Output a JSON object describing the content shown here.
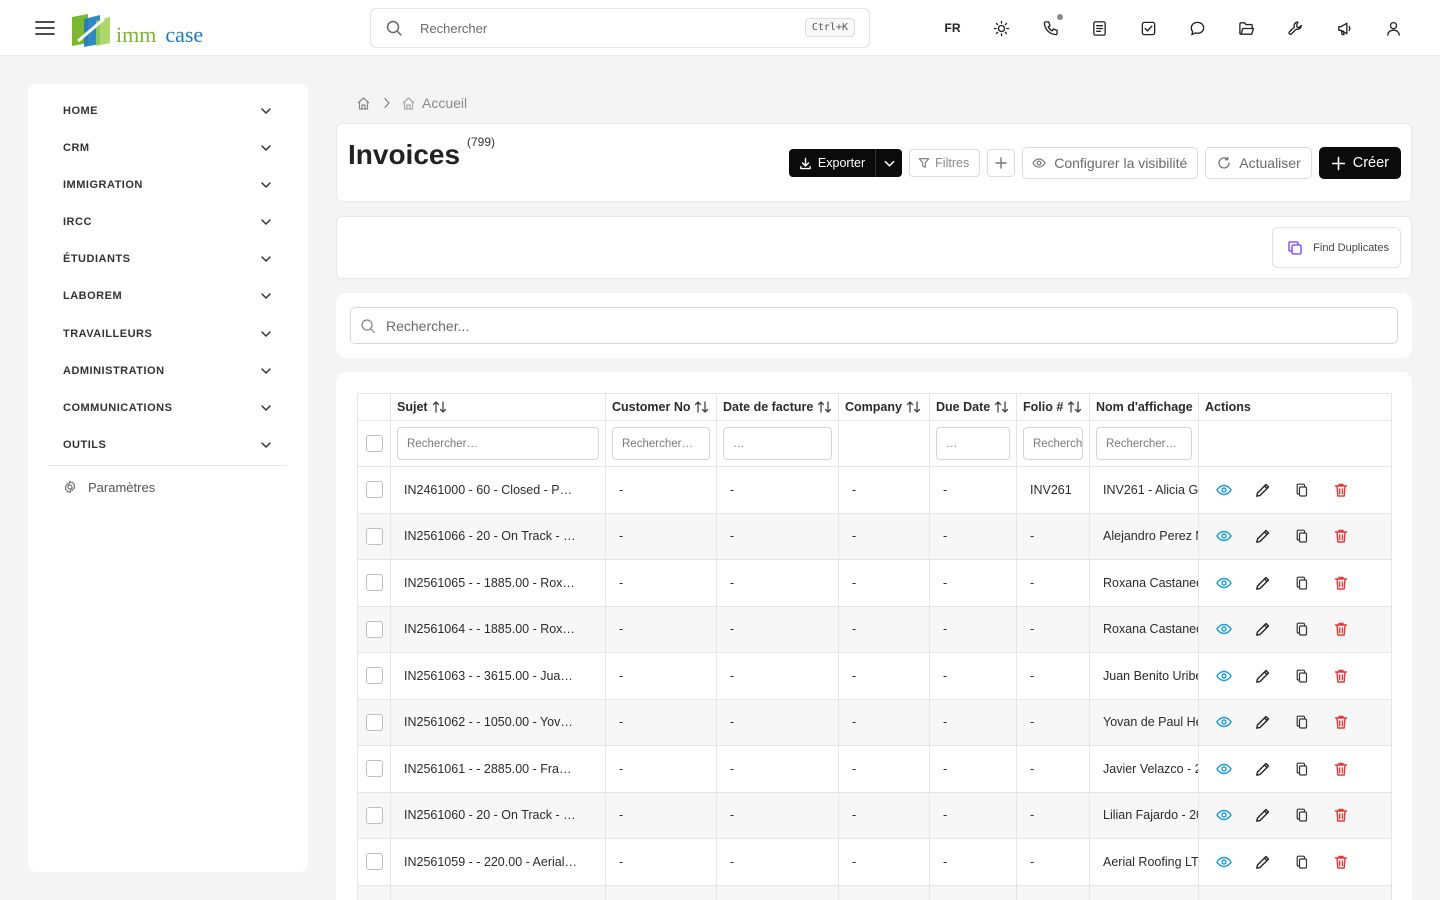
{
  "header": {
    "logo_text_left": "imm",
    "logo_text_right": "case",
    "search_placeholder": "Rechercher",
    "search_shortcut": "Ctrl+K",
    "language": "FR",
    "icons": [
      "sun-icon",
      "phone-icon",
      "notes-icon",
      "tasks-icon",
      "chat-icon",
      "folder-icon",
      "wrench-icon",
      "megaphone-icon",
      "user-icon"
    ]
  },
  "sidebar": {
    "items": [
      {
        "label": "HOME"
      },
      {
        "label": "CRM"
      },
      {
        "label": "IMMIGRATION"
      },
      {
        "label": "IRCC"
      },
      {
        "label": "ÉTUDIANTS"
      },
      {
        "label": "LABOREM"
      },
      {
        "label": "TRAVAILLEURS"
      },
      {
        "label": "ADMINISTRATION"
      },
      {
        "label": "COMMUNICATIONS"
      },
      {
        "label": "OUTILS"
      }
    ],
    "settings_label": "Paramètres"
  },
  "breadcrumb": {
    "current": "Accueil"
  },
  "page": {
    "title": "Invoices",
    "count": "(799)"
  },
  "toolbar": {
    "export_label": "Exporter",
    "filters_label": "Filtres",
    "visibility_label": "Configurer la visibilité",
    "refresh_label": "Actualiser",
    "create_label": "Créer"
  },
  "duplicates": {
    "label": "Find Duplicates"
  },
  "search": {
    "placeholder": "Rechercher..."
  },
  "table": {
    "columns": [
      {
        "label": "Sujet",
        "sortable": true
      },
      {
        "label": "Customer No",
        "sortable": true
      },
      {
        "label": "Date de facture",
        "sortable": true
      },
      {
        "label": "Company",
        "sortable": true
      },
      {
        "label": "Due Date",
        "sortable": true
      },
      {
        "label": "Folio #",
        "sortable": true
      },
      {
        "label": "Nom d'affichage",
        "sortable": false
      },
      {
        "label": "Actions",
        "sortable": false
      }
    ],
    "filters": {
      "sujet": "Rechercher…",
      "customer_no": "Rechercher…",
      "date_facture": "…",
      "due_date": "…",
      "folio": "Rechercher…",
      "nom": "Rechercher…"
    },
    "rows": [
      {
        "sujet": "IN2461000 - 60 - Closed - P…",
        "customer_no": "-",
        "date_facture": "-",
        "company": "-",
        "due_date": "-",
        "folio": "INV261",
        "nom": "INV261 - Alicia G"
      },
      {
        "sujet": "IN2561066 - 20 - On Track - …",
        "customer_no": "-",
        "date_facture": "-",
        "company": "-",
        "due_date": "-",
        "folio": "-",
        "nom": "Alejandro Perez M"
      },
      {
        "sujet": "IN2561065 - - 1885.00 - Rox…",
        "customer_no": "-",
        "date_facture": "-",
        "company": "-",
        "due_date": "-",
        "folio": "-",
        "nom": "Roxana Castaned"
      },
      {
        "sujet": "IN2561064 - - 1885.00 - Rox…",
        "customer_no": "-",
        "date_facture": "-",
        "company": "-",
        "due_date": "-",
        "folio": "-",
        "nom": "Roxana Castaned"
      },
      {
        "sujet": "IN2561063 - - 3615.00 - Jua…",
        "customer_no": "-",
        "date_facture": "-",
        "company": "-",
        "due_date": "-",
        "folio": "-",
        "nom": "Juan Benito Uribe"
      },
      {
        "sujet": "IN2561062 - - 1050.00 - Yov…",
        "customer_no": "-",
        "date_facture": "-",
        "company": "-",
        "due_date": "-",
        "folio": "-",
        "nom": "Yovan de Paul He"
      },
      {
        "sujet": "IN2561061 - - 2885.00 - Fra…",
        "customer_no": "-",
        "date_facture": "-",
        "company": "-",
        "due_date": "-",
        "folio": "-",
        "nom": "Javier Velazco - 2"
      },
      {
        "sujet": "IN2561060 - 20 - On Track - …",
        "customer_no": "-",
        "date_facture": "-",
        "company": "-",
        "due_date": "-",
        "folio": "-",
        "nom": "Lilian Fajardo - 20"
      },
      {
        "sujet": "IN2561059 - - 220.00 - Aerial…",
        "customer_no": "-",
        "date_facture": "-",
        "company": "-",
        "due_date": "-",
        "folio": "-",
        "nom": "Aerial Roofing LT"
      }
    ]
  },
  "colors": {
    "view_icon": "#1a9bd7",
    "delete_icon": "#e53935",
    "logo_green": "#7cb82f",
    "logo_blue": "#1a7bbf",
    "dup_icon": "#7c3aed"
  }
}
